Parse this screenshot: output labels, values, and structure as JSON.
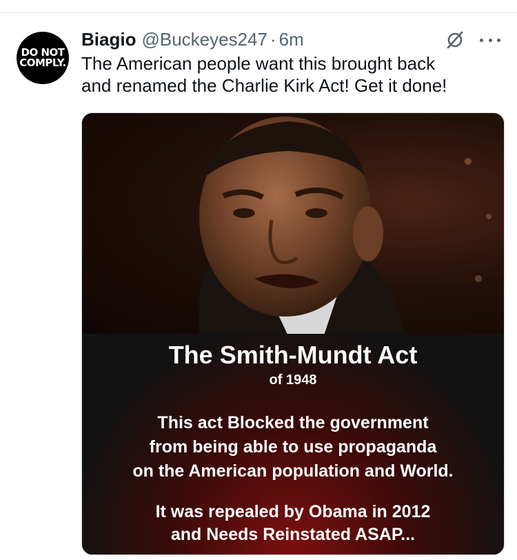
{
  "tweet": {
    "avatar_text": [
      "DO NOT",
      "COMPLY."
    ],
    "author_name": "Biagio",
    "handle": "@Buckeyes247",
    "separator": "·",
    "time": "6m",
    "text": "The American people want this brought back\nand renamed the Charlie Kirk Act! Get it done!",
    "icons": {
      "grok": "slashed-circle-icon",
      "more": "more-options-icon"
    }
  },
  "image": {
    "title": "The Smith-Mundt Act",
    "subtitle": "of 1948",
    "body": "This act Blocked the government\nfrom being able to use propaganda\non the American population and World.",
    "footer": "It was repealed by Obama in 2012\nand Needs Reinstated ASAP..."
  },
  "colors": {
    "text_primary": "#0f1419",
    "text_secondary": "#536471",
    "divider": "#e6e9ec"
  }
}
